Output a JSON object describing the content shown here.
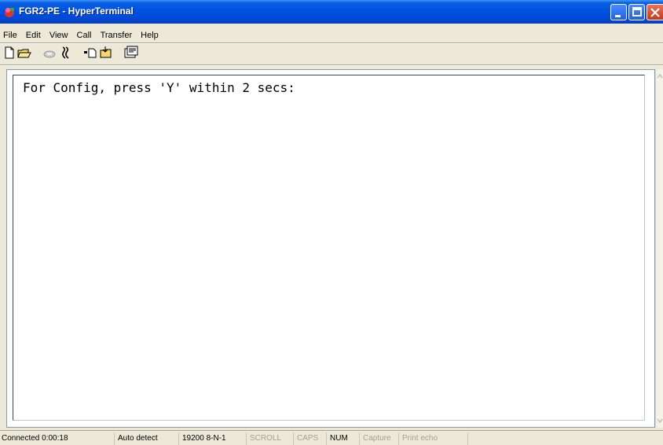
{
  "window": {
    "title": "FGR2-PE - HyperTerminal"
  },
  "menu": [
    "File",
    "Edit",
    "View",
    "Call",
    "Transfer",
    "Help"
  ],
  "toolbar": {
    "icons": [
      "new-document-icon",
      "open-folder-icon",
      "phone-icon",
      "disconnect-icon",
      "send-icon",
      "receive-icon",
      "properties-icon"
    ]
  },
  "terminal": {
    "text": "For Config, press 'Y' within 2 secs:"
  },
  "status": {
    "connected": "Connected 0:00:18",
    "detect": "Auto detect",
    "settings": "19200 8-N-1",
    "scroll": "SCROLL",
    "caps": "CAPS",
    "num": "NUM",
    "capture": "Capture",
    "print_echo": "Print echo"
  },
  "colors": {
    "titlebar": "#0054e3",
    "chrome": "#ece9d8",
    "terminal_bg": "#ffffff"
  }
}
